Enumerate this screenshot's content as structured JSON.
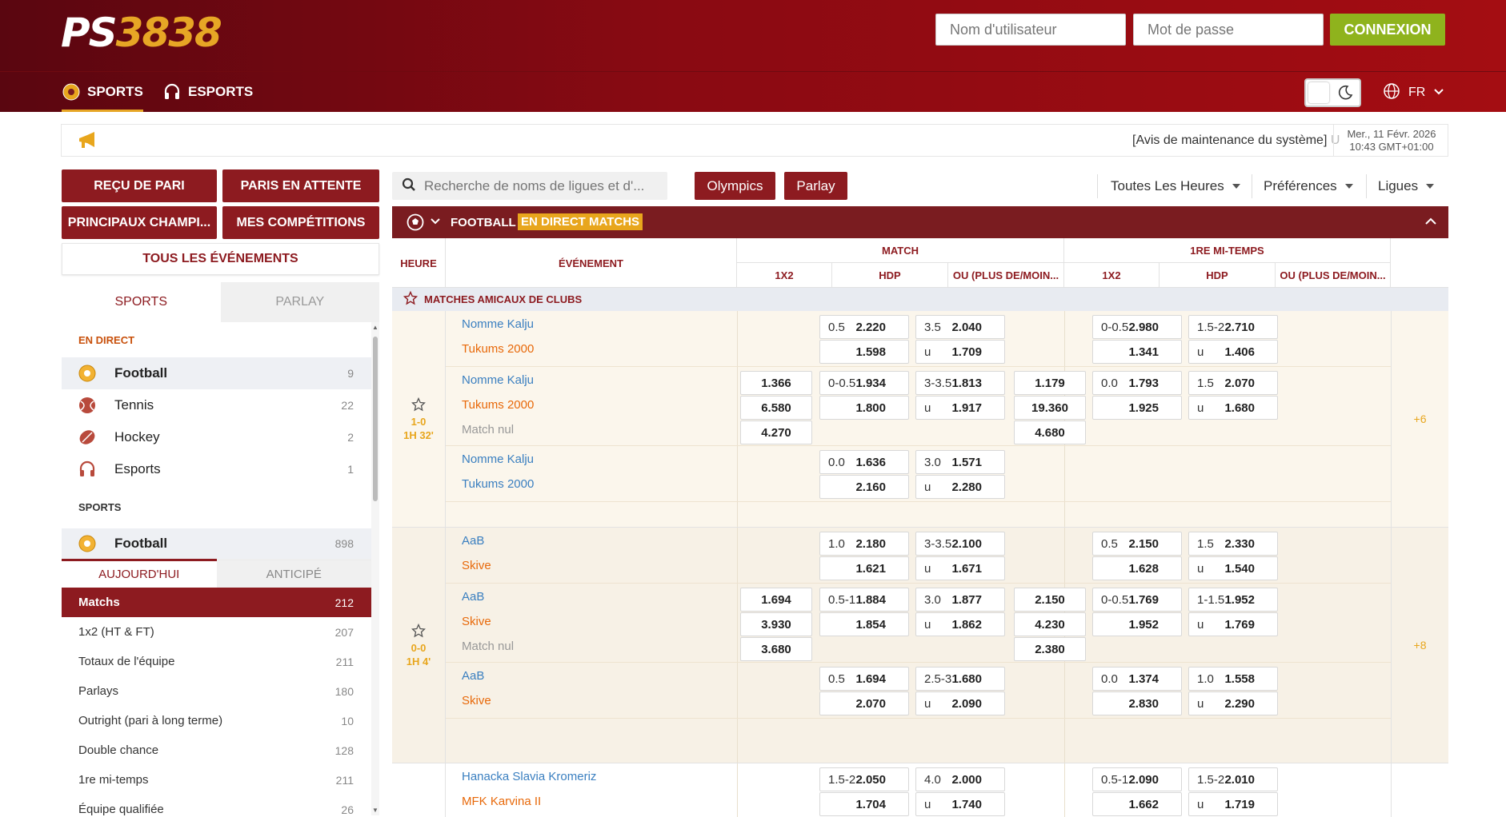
{
  "header": {
    "logo_ps": "PS",
    "logo_num": "3838",
    "username_placeholder": "Nom d'utilisateur",
    "password_placeholder": "Mot de passe",
    "login_label": "CONNEXION"
  },
  "nav": {
    "sports": "SPORTS",
    "esports": "ESPORTS",
    "lang": "FR"
  },
  "announce": {
    "message": "[Avis de maintenance du système]",
    "message_fade": "U",
    "date_line1": "Mer., 11 Févr. 2026",
    "date_line2": "10:43 GMT+01:00"
  },
  "sidebar": {
    "btn_receipt": "REÇU DE PARI",
    "btn_pending": "PARIS EN ATTENTE",
    "btn_champs": "PRINCIPAUX CHAMPI...",
    "btn_mycomp": "MES COMPÉTITIONS",
    "btn_all": "TOUS LES ÉVÉNEMENTS",
    "tab_sports": "SPORTS",
    "tab_parlay": "PARLAY",
    "section_live": "EN DIRECT",
    "live_sports": [
      {
        "name": "Football",
        "count": "9"
      },
      {
        "name": "Tennis",
        "count": "22"
      },
      {
        "name": "Hockey",
        "count": "2"
      },
      {
        "name": "Esports",
        "count": "1"
      }
    ],
    "section_sports": "SPORTS",
    "sport_football": {
      "name": "Football",
      "count": "898"
    },
    "subtab_today": "AUJOURD'HUI",
    "subtab_early": "ANTICIPÉ",
    "markets": [
      {
        "name": "Matchs",
        "count": "212"
      },
      {
        "name": "1x2 (HT & FT)",
        "count": "207"
      },
      {
        "name": "Totaux de l'équipe",
        "count": "211"
      },
      {
        "name": "Parlays",
        "count": "180"
      },
      {
        "name": "Outright (pari à long terme)",
        "count": "10"
      },
      {
        "name": "Double chance",
        "count": "128"
      },
      {
        "name": "1re mi-temps",
        "count": "211"
      },
      {
        "name": "Équipe qualifiée",
        "count": "26"
      }
    ]
  },
  "toolbar": {
    "search_placeholder": "Recherche de noms de ligues et d'...",
    "olympics": "Olympics",
    "parlay": "Parlay",
    "all_hours": "Toutes Les Heures",
    "preferences": "Préférences",
    "leagues": "Ligues"
  },
  "table": {
    "sport_title": "FOOTBALL",
    "live_badge": "EN DIRECT MATCHS",
    "col_time": "HEURE",
    "col_event": "ÉVÉNEMENT",
    "col_match": "MATCH",
    "col_half": "1RE MI-TEMPS",
    "sub_1x2": "1X2",
    "sub_hdp": "HDP",
    "sub_ou": "OU (PLUS DE/MOIN...",
    "league": "MATCHES AMICAUX DE CLUBS",
    "matches": [
      {
        "score": "1-0",
        "clock": "1H 32'",
        "extra": "+6",
        "lines": [
          {
            "home": "Nomme Kalju",
            "away": "Tukums 2000",
            "away_orange": true,
            "hdp_h": "0.5",
            "hdp_ho": "2.220",
            "hdp_ao": "1.598",
            "ou_h": "3.5",
            "ou_o": "2.040",
            "ou_u": "u",
            "ou_uo": "1.709",
            "h_hdp_h": "0-0.5",
            "h_hdp_ho": "2.980",
            "h_hdp_ao": "1.341",
            "h_ou_h": "1.5-2",
            "h_ou_o": "2.710",
            "h_ou_u": "u",
            "h_ou_uo": "1.406"
          },
          {
            "home": "Nomme Kalju",
            "away": "Tukums 2000",
            "draw": "Match nul",
            "away_orange": true,
            "x1": "1.366",
            "x2": "6.580",
            "xx": "4.270",
            "hdp_h": "0-0.5",
            "hdp_ho": "1.934",
            "hdp_ao": "1.800",
            "ou_h": "3-3.5",
            "ou_o": "1.813",
            "ou_u": "u",
            "ou_uo": "1.917",
            "h_x1": "1.179",
            "h_x2": "19.360",
            "h_xx": "4.680",
            "h_hdp_h": "0.0",
            "h_hdp_ho": "1.793",
            "h_hdp_ao": "1.925",
            "h_ou_h": "1.5",
            "h_ou_o": "2.070",
            "h_ou_u": "u",
            "h_ou_uo": "1.680"
          },
          {
            "home": "Nomme Kalju",
            "away": "Tukums 2000",
            "away_orange": false,
            "hdp_h": "0.0",
            "hdp_ho": "1.636",
            "hdp_ao": "2.160",
            "ou_h": "3.0",
            "ou_o": "1.571",
            "ou_u": "u",
            "ou_uo": "2.280"
          }
        ]
      },
      {
        "score": "0-0",
        "clock": "1H 4'",
        "extra": "+8",
        "lines": [
          {
            "home": "AaB",
            "away": "Skive",
            "away_orange": true,
            "hdp_h": "1.0",
            "hdp_ho": "2.180",
            "hdp_ao": "1.621",
            "ou_h": "3-3.5",
            "ou_o": "2.100",
            "ou_u": "u",
            "ou_uo": "1.671",
            "h_hdp_h": "0.5",
            "h_hdp_ho": "2.150",
            "h_hdp_ao": "1.628",
            "h_ou_h": "1.5",
            "h_ou_o": "2.330",
            "h_ou_u": "u",
            "h_ou_uo": "1.540"
          },
          {
            "home": "AaB",
            "away": "Skive",
            "draw": "Match nul",
            "away_orange": true,
            "x1": "1.694",
            "x2": "3.930",
            "xx": "3.680",
            "hdp_h": "0.5-1",
            "hdp_ho": "1.884",
            "hdp_ao": "1.854",
            "ou_h": "3.0",
            "ou_o": "1.877",
            "ou_u": "u",
            "ou_uo": "1.862",
            "h_x1": "2.150",
            "h_x2": "4.230",
            "h_xx": "2.380",
            "h_hdp_h": "0-0.5",
            "h_hdp_ho": "1.769",
            "h_hdp_ao": "1.952",
            "h_ou_h": "1-1.5",
            "h_ou_o": "1.952",
            "h_ou_u": "u",
            "h_ou_uo": "1.769"
          },
          {
            "home": "AaB",
            "away": "Skive",
            "away_orange": true,
            "hdp_h": "0.5",
            "hdp_ho": "1.694",
            "hdp_ao": "2.070",
            "ou_h": "2.5-3",
            "ou_o": "1.680",
            "ou_u": "u",
            "ou_uo": "2.090",
            "h_hdp_h": "0.0",
            "h_hdp_ho": "1.374",
            "h_hdp_ao": "2.830",
            "h_ou_h": "1.0",
            "h_ou_o": "1.558",
            "h_ou_u": "u",
            "h_ou_uo": "2.290"
          }
        ]
      },
      {
        "score": "",
        "clock": "",
        "extra": "",
        "lines": [
          {
            "home": "Hanacka Slavia Kromeriz",
            "away": "MFK Karvina II",
            "away_orange": true,
            "hdp_h": "1.5-2",
            "hdp_ho": "2.050",
            "hdp_ao": "1.704",
            "ou_h": "4.0",
            "ou_o": "2.000",
            "ou_u": "u",
            "ou_uo": "1.740",
            "h_hdp_h": "0.5-1",
            "h_hdp_ho": "2.090",
            "h_hdp_ao": "1.662",
            "h_ou_h": "1.5-2",
            "h_ou_o": "2.010",
            "h_ou_u": "u",
            "h_ou_uo": "1.719"
          }
        ]
      }
    ]
  },
  "colors": {
    "brand_dark": "#7a1c20",
    "accent_gold": "#e8a61d",
    "login_green": "#8fb31d",
    "home_blue": "#3a7fc0",
    "away_orange": "#e8690a"
  }
}
